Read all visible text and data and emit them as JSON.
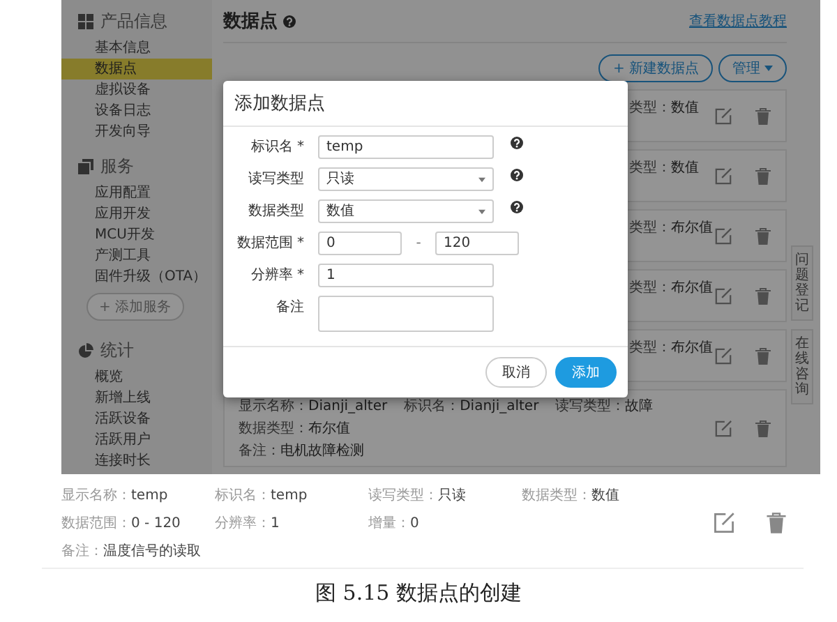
{
  "sidebar": {
    "sections": [
      {
        "title": "产品信息",
        "items": [
          {
            "label": "基本信息",
            "selected": false
          },
          {
            "label": "数据点",
            "selected": true
          },
          {
            "label": "虚拟设备",
            "selected": false
          },
          {
            "label": "设备日志",
            "selected": false
          },
          {
            "label": "开发向导",
            "selected": false
          }
        ]
      },
      {
        "title": "服务",
        "items": [
          {
            "label": "应用配置",
            "selected": false
          },
          {
            "label": "应用开发",
            "selected": false
          },
          {
            "label": "MCU开发",
            "selected": false
          },
          {
            "label": "产测工具",
            "selected": false
          },
          {
            "label": "固件升级（OTA）",
            "selected": false
          }
        ],
        "add_button": "+ 添加服务"
      },
      {
        "title": "统计",
        "items": [
          {
            "label": "概览",
            "selected": false
          },
          {
            "label": "新增上线",
            "selected": false
          },
          {
            "label": "活跃设备",
            "selected": false
          },
          {
            "label": "活跃用户",
            "selected": false
          },
          {
            "label": "连接时长",
            "selected": false
          }
        ]
      }
    ]
  },
  "main": {
    "title": "数据点",
    "tutorial_link": "查看数据点教程",
    "new_button": "+ 新建数据点",
    "manage_button": "管理",
    "cards": [
      {
        "kind": "partial",
        "label": "类型：",
        "value": "数值"
      },
      {
        "kind": "partial",
        "label": "类型：",
        "value": "数值"
      },
      {
        "kind": "partial",
        "label": "类型：",
        "value": "布尔值"
      },
      {
        "kind": "partial",
        "label": "类型：",
        "value": "布尔值"
      },
      {
        "kind": "partial",
        "label": "类型：",
        "value": "布尔值"
      },
      {
        "kind": "full",
        "fields": [
          {
            "label": "显示名称：",
            "value": "Dianji_alter"
          },
          {
            "label": "标识名：",
            "value": "Dianji_alter"
          },
          {
            "label": "读写类型：",
            "value": "故障"
          },
          {
            "label": "数据类型：",
            "value": "布尔值"
          }
        ],
        "note": {
          "label": "备注：",
          "value": "电机故障检测"
        }
      }
    ]
  },
  "side_tabs": [
    "问题登记",
    "在线咨询"
  ],
  "modal": {
    "title": "添加数据点",
    "fields": [
      {
        "kind": "text",
        "label": "标识名 *",
        "value": "temp",
        "help": true
      },
      {
        "kind": "select",
        "label": "读写类型",
        "value": "只读",
        "help": true
      },
      {
        "kind": "select",
        "label": "数据类型",
        "value": "数值",
        "help": true
      },
      {
        "kind": "range",
        "label": "数据范围 *",
        "min": "0",
        "separator": "-",
        "max": "120",
        "help": false
      },
      {
        "kind": "text",
        "label": "分辨率 *",
        "value": "1",
        "help": false
      },
      {
        "kind": "textarea",
        "label": "备注",
        "help": false
      }
    ],
    "cancel_button": "取消",
    "submit_button": "添加"
  },
  "detail": {
    "rows": [
      [
        {
          "label": "显示名称：",
          "value": "temp"
        },
        {
          "label": "标识名：",
          "value": "temp"
        },
        {
          "label": "读写类型：",
          "value": "只读"
        },
        {
          "label": "数据类型：",
          "value": "数值"
        }
      ],
      [
        {
          "label": "数据范围：",
          "value": "0 - 120"
        },
        {
          "label": "分辨率：",
          "value": "1"
        },
        {
          "label": "增量：",
          "value": "0"
        }
      ],
      [
        {
          "label": "备注：",
          "value": "温度信号的读取"
        }
      ]
    ]
  },
  "caption": "图 5.15 数据点的创建"
}
